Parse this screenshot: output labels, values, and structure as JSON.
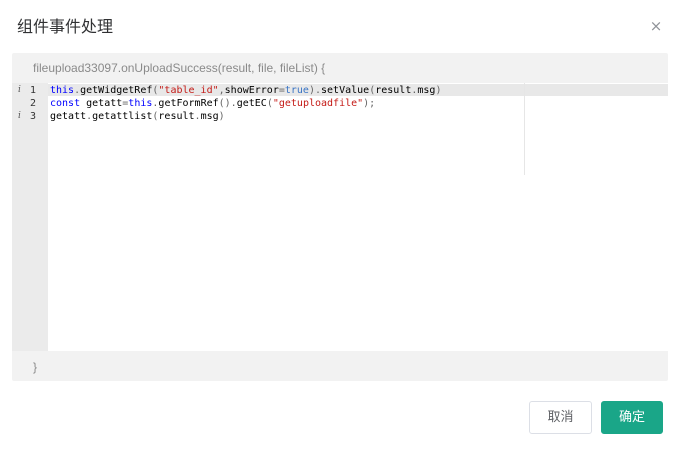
{
  "dialog": {
    "title": "组件事件处理",
    "close_glyph": "×"
  },
  "editor": {
    "header": "fileupload33097.onUploadSuccess(result, file, fileList) {",
    "footer": "}",
    "gutter": [
      {
        "num": "1",
        "info": "i"
      },
      {
        "num": "2",
        "info": ""
      },
      {
        "num": "3",
        "info": "i"
      }
    ],
    "lines": [
      [
        {
          "t": "kw",
          "v": "this"
        },
        {
          "t": "pn",
          "v": "."
        },
        {
          "t": "id",
          "v": "getWidgetRef"
        },
        {
          "t": "pn",
          "v": "("
        },
        {
          "t": "str",
          "v": "\"table_id\""
        },
        {
          "t": "pn",
          "v": ","
        },
        {
          "t": "id",
          "v": "showError"
        },
        {
          "t": "pn",
          "v": "="
        },
        {
          "t": "const",
          "v": "true"
        },
        {
          "t": "pn",
          "v": ")."
        },
        {
          "t": "id",
          "v": "setValue"
        },
        {
          "t": "pn",
          "v": "("
        },
        {
          "t": "id",
          "v": "result"
        },
        {
          "t": "pn",
          "v": "."
        },
        {
          "t": "id",
          "v": "msg"
        },
        {
          "t": "pn",
          "v": ")"
        }
      ],
      [
        {
          "t": "kw",
          "v": "const"
        },
        {
          "t": "id",
          "v": " getatt"
        },
        {
          "t": "pn",
          "v": "="
        },
        {
          "t": "kw",
          "v": "this"
        },
        {
          "t": "pn",
          "v": "."
        },
        {
          "t": "id",
          "v": "getFormRef"
        },
        {
          "t": "pn",
          "v": "()."
        },
        {
          "t": "id",
          "v": "getEC"
        },
        {
          "t": "pn",
          "v": "("
        },
        {
          "t": "str",
          "v": "\"getuploadfile\""
        },
        {
          "t": "pn",
          "v": ");"
        }
      ],
      [
        {
          "t": "id",
          "v": "getatt"
        },
        {
          "t": "pn",
          "v": "."
        },
        {
          "t": "id",
          "v": "getattlist"
        },
        {
          "t": "pn",
          "v": "("
        },
        {
          "t": "id",
          "v": "result"
        },
        {
          "t": "pn",
          "v": "."
        },
        {
          "t": "id",
          "v": "msg"
        },
        {
          "t": "pn",
          "v": ")"
        }
      ]
    ]
  },
  "buttons": {
    "cancel_label": "取消",
    "ok_label": "确定"
  },
  "colors": {
    "primary": "#1aa688",
    "keyword": "#0000ff",
    "string": "#c41a16"
  }
}
